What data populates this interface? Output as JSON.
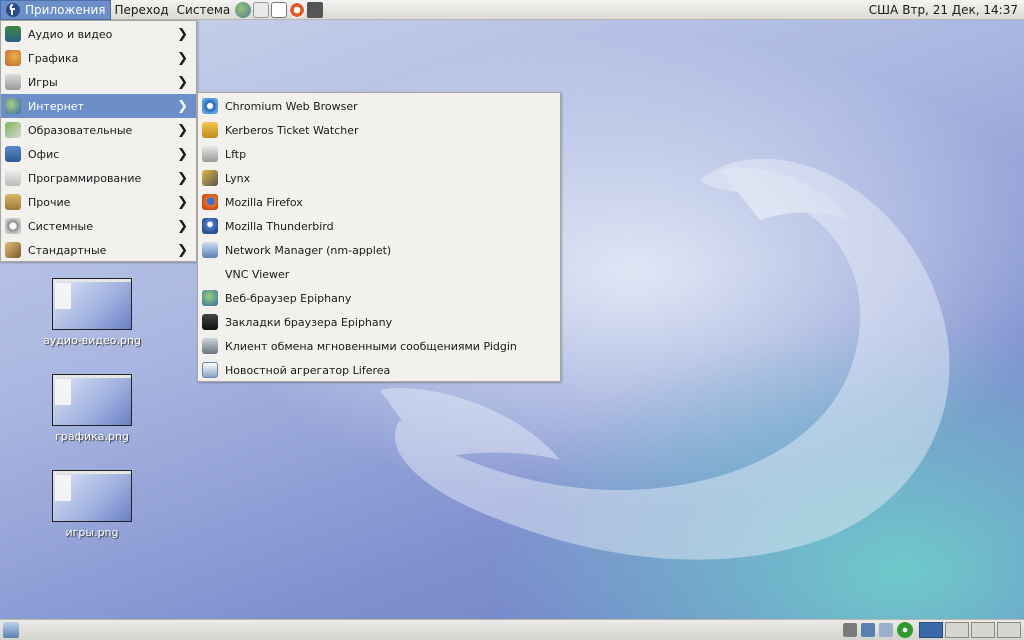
{
  "top_panel": {
    "applications": "Приложения",
    "places": "Переход",
    "system": "Система",
    "launchers": [
      "epiphany-launcher-icon",
      "evolution-launcher-icon",
      "terminal-launcher-icon",
      "help-launcher-icon",
      "screenshot-launcher-icon"
    ],
    "keyboard_layout": "США",
    "clock": "Втр, 21 Дек, 14:37"
  },
  "apps_menu": {
    "items": [
      {
        "label": "Аудио и видео",
        "icon": "audio-video-icon"
      },
      {
        "label": "Графика",
        "icon": "graphics-icon"
      },
      {
        "label": "Игры",
        "icon": "games-icon"
      },
      {
        "label": "Интернет",
        "icon": "internet-icon"
      },
      {
        "label": "Образовательные",
        "icon": "education-icon"
      },
      {
        "label": "Офис",
        "icon": "office-icon"
      },
      {
        "label": "Программирование",
        "icon": "programming-icon"
      },
      {
        "label": "Прочие",
        "icon": "other-icon"
      },
      {
        "label": "Системные",
        "icon": "system-icon"
      },
      {
        "label": "Стандартные",
        "icon": "accessories-icon"
      }
    ],
    "highlighted": "Интернет"
  },
  "internet_menu": {
    "items": [
      {
        "label": "Chromium Web Browser",
        "icon": "chromium-icon"
      },
      {
        "label": "Kerberos Ticket Watcher",
        "icon": "kerberos-icon"
      },
      {
        "label": "Lftp",
        "icon": "lftp-icon"
      },
      {
        "label": "Lynx",
        "icon": "lynx-icon"
      },
      {
        "label": "Mozilla Firefox",
        "icon": "firefox-icon"
      },
      {
        "label": "Mozilla Thunderbird",
        "icon": "thunderbird-icon"
      },
      {
        "label": "Network Manager (nm-applet)",
        "icon": "network-manager-icon"
      },
      {
        "label": "VNC Viewer",
        "icon": "vnc-viewer-icon"
      },
      {
        "label": "Веб-браузер Epiphany",
        "icon": "epiphany-icon"
      },
      {
        "label": "Закладки браузера Epiphany",
        "icon": "epiphany-bookmarks-icon"
      },
      {
        "label": "Клиент обмена мгновенными сообщениями Pidgin",
        "icon": "pidgin-icon"
      },
      {
        "label": "Новостной агрегатор Liferea",
        "icon": "liferea-icon"
      }
    ]
  },
  "desktop_icons": [
    {
      "label": "аудио-видео.png",
      "icon": "image-thumbnail-icon"
    },
    {
      "label": "графика.png",
      "icon": "image-thumbnail-icon"
    },
    {
      "label": "игры.png",
      "icon": "image-thumbnail-icon"
    }
  ],
  "bottom_panel": {
    "show_desktop_icon": "show-desktop-icon",
    "tray_icons": [
      "volume-icon",
      "network-icon",
      "clipboard-icon",
      "update-icon"
    ],
    "workspaces": 4,
    "active_workspace": 1
  },
  "colors": {
    "highlight": "#6d8fc9",
    "menu_bg": "#f2f1ee",
    "panel_bg": "#dcdad5"
  }
}
